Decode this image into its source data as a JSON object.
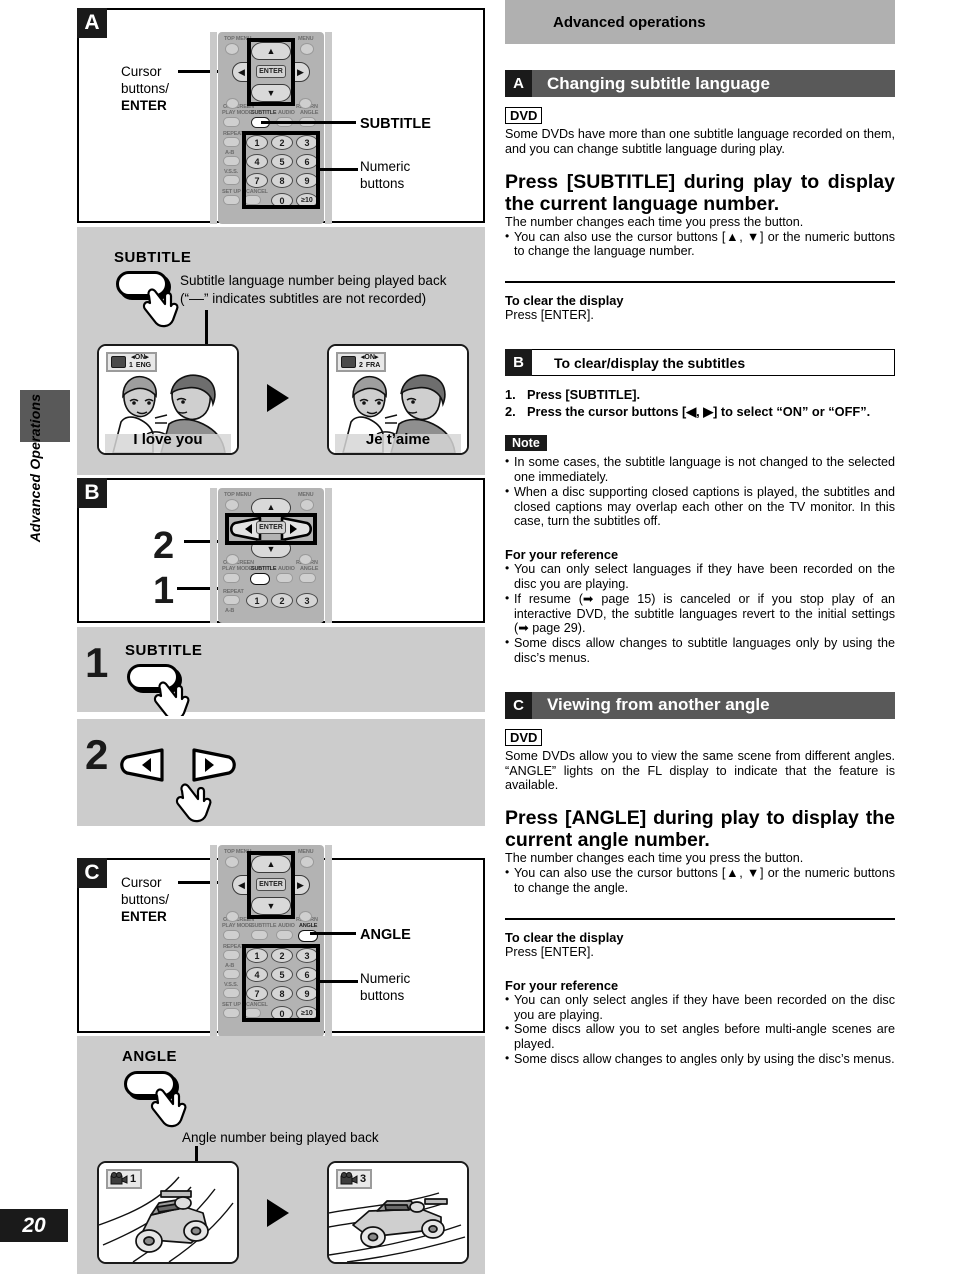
{
  "page": {
    "number": "20",
    "side_label": "Advanced Operations",
    "header_title": "Advanced operations"
  },
  "left_column": {
    "panel_a": {
      "badge": "A",
      "callout_cursor_line1": "Cursor",
      "callout_cursor_line2": "buttons/",
      "callout_cursor_line3": "ENTER",
      "callout_subtitle": "SUBTITLE",
      "callout_numeric_line1": "Numeric",
      "callout_numeric_line2": "buttons"
    },
    "subtitle_demo": {
      "button_label": "SUBTITLE",
      "note_line1": "Subtitle language number being played back",
      "note_line2": "(“––” indicates subtitles are not recorded)",
      "screen_left": {
        "osd_top": "◂ON▸",
        "osd_num": "1",
        "osd_lang": "ENG",
        "caption": "I love you"
      },
      "screen_right": {
        "osd_top": "◂ON▸",
        "osd_num": "2",
        "osd_lang": "FRA",
        "caption": "Je t’aime"
      }
    },
    "panel_b": {
      "badge": "B",
      "marker_2": "2",
      "marker_1": "1"
    },
    "step_1": {
      "number": "1",
      "button_label": "SUBTITLE"
    },
    "step_2": {
      "number": "2"
    },
    "panel_c": {
      "badge": "C",
      "callout_cursor_line1": "Cursor",
      "callout_cursor_line2": "buttons/",
      "callout_cursor_line3": "ENTER",
      "callout_angle": "ANGLE",
      "callout_numeric_line1": "Numeric",
      "callout_numeric_line2": "buttons"
    },
    "angle_demo": {
      "button_label": "ANGLE",
      "note": "Angle number being played back",
      "screen_left": {
        "osd_num": "1"
      },
      "screen_right": {
        "osd_num": "3"
      }
    },
    "remote_labels": {
      "top_menu": "TOP MENU",
      "menu": "MENU",
      "on_screen": "ON SCREEN",
      "return": "RETURN",
      "play_mode": "PLAY MODE",
      "subtitle": "SUBTITLE",
      "audio": "AUDIO",
      "angle": "ANGLE",
      "repeat": "REPEAT",
      "a_b": "A-B",
      "vss": "V.S.S.",
      "set_up": "SET UP",
      "cancel": "CANCEL",
      "enter": "ENTER",
      "keys": [
        "1",
        "2",
        "3",
        "4",
        "5",
        "6",
        "7",
        "8",
        "9",
        "0",
        "≥10"
      ]
    }
  },
  "right_column": {
    "section_a": {
      "badge": "A",
      "title": "Changing subtitle language",
      "disc_badge": "DVD",
      "intro": "Some DVDs have more than one subtitle language recorded on them, and you can change subtitle language during play.",
      "heading": "Press [SUBTITLE] during play to display the current language number.",
      "lead": "The number changes each time you press the button.",
      "bullets": [
        "You can also use the cursor buttons [▲, ▼] or the numeric buttons to change the language number."
      ],
      "clear_title": "To clear the display",
      "clear_body": "Press [ENTER]."
    },
    "section_b": {
      "badge": "B",
      "title": "To clear/display the subtitles",
      "steps": [
        {
          "n": "1.",
          "text": "Press [SUBTITLE]."
        },
        {
          "n": "2.",
          "text": "Press the cursor buttons [◀, ▶] to select “ON” or “OFF”."
        }
      ],
      "note_badge": "Note",
      "note_bullets": [
        "In some cases, the subtitle language is not changed to the selected one immediately.",
        "When a disc supporting closed captions is played, the subtitles and closed captions may overlap each other on the TV monitor. In this case, turn the subtitles off."
      ],
      "reference_title": "For your reference",
      "reference_bullets": [
        "You can only select languages if they have been recorded on the disc you are playing.",
        "If resume (➡ page 15) is canceled or if you stop play of an interactive DVD, the subtitle languages revert to the initial settings (➡ page 29).",
        "Some discs allow changes to subtitle languages only by using the disc’s menus."
      ]
    },
    "section_c": {
      "badge": "C",
      "title": "Viewing from another angle",
      "disc_badge": "DVD",
      "intro": "Some DVDs allow you to view the same scene from different angles. “ANGLE” lights on the FL display to indicate that the feature is available.",
      "heading": "Press [ANGLE] during play to display the current angle number.",
      "lead": "The number changes each time you press the button.",
      "bullets": [
        "You can also use the cursor buttons [▲, ▼] or the numeric buttons to change the angle."
      ],
      "clear_title": "To clear the display",
      "clear_body": "Press [ENTER].",
      "reference_title": "For your reference",
      "reference_bullets": [
        "You can only select angles if they have been recorded on the disc you are playing.",
        "Some discs allow you to set angles before multi-angle scenes are played.",
        "Some discs allow changes to angles only by using the disc’s menus."
      ]
    }
  }
}
